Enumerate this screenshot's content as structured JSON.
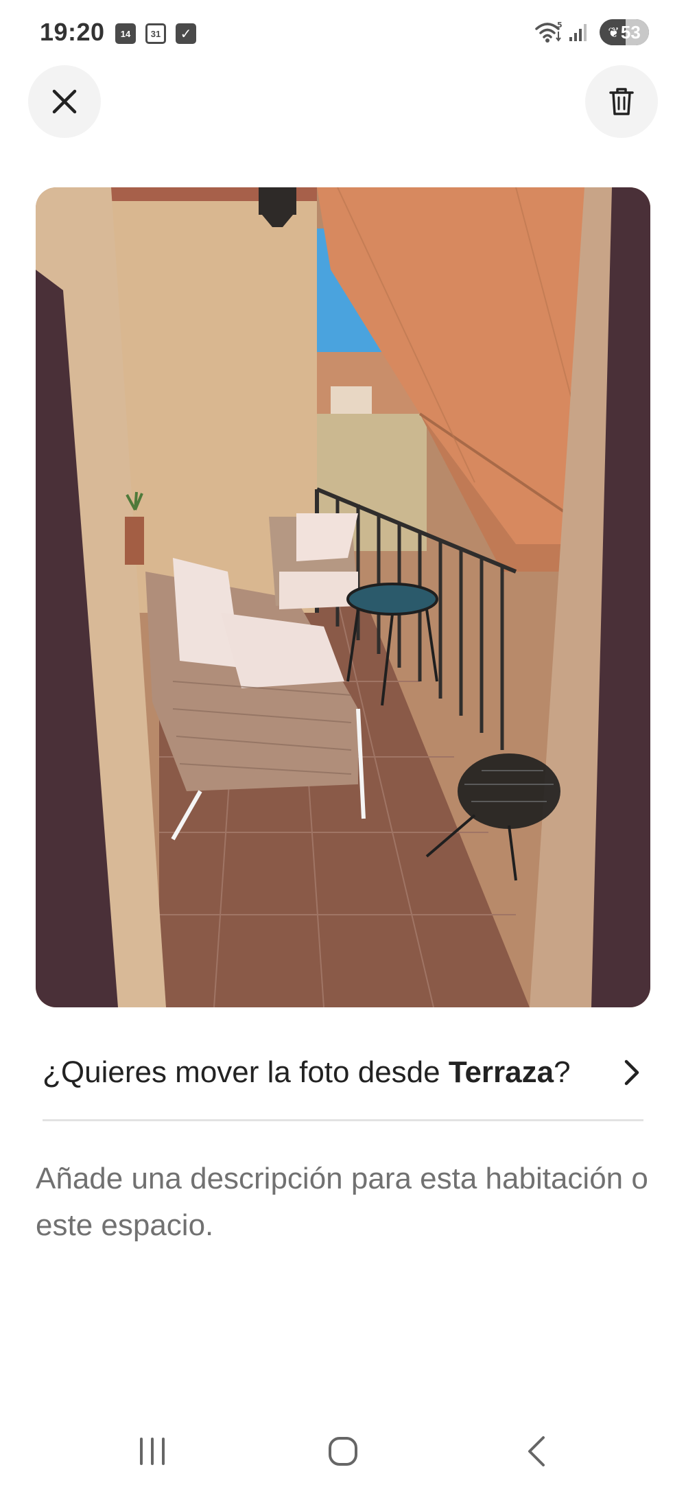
{
  "status_bar": {
    "time": "19:20",
    "notifications": {
      "calendar_filled": "14",
      "calendar_outline": "31",
      "checkbox": "✓"
    },
    "wifi_badge": "5",
    "battery": "53"
  },
  "header": {
    "close_icon": "close-icon",
    "delete_icon": "trash-icon"
  },
  "photo": {
    "subject": "terrace-photo"
  },
  "move_prompt": {
    "prefix": "¿Quieres mover la foto desde ",
    "room": "Terraza",
    "suffix": "?"
  },
  "description": {
    "placeholder": "Añade una descripción para esta habitación o este espacio."
  },
  "nav_bar": {
    "recents_icon": "recents-icon",
    "home_icon": "home-icon",
    "back_icon": "back-icon"
  },
  "colors": {
    "text_primary": "#222222",
    "text_secondary": "#717171",
    "button_bg": "#f3f3f3",
    "divider": "#e2e2e2"
  }
}
